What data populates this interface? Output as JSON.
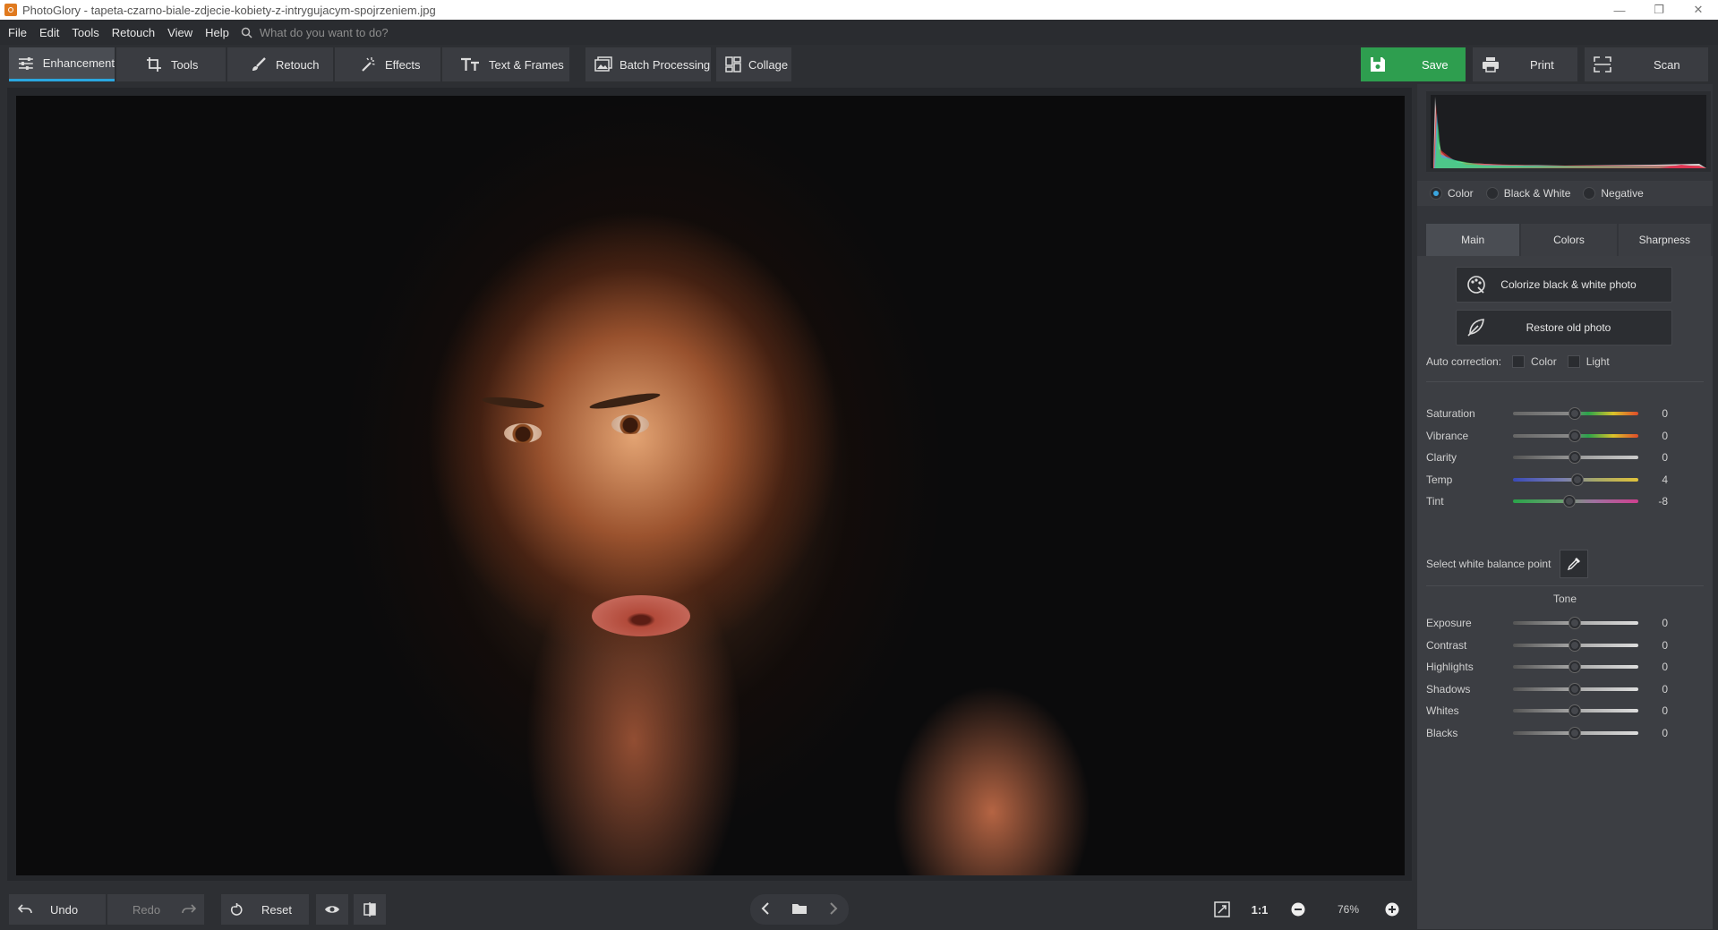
{
  "window": {
    "title": "PhotoGlory - tapeta-czarno-biale-zdjecie-kobiety-z-intrygujacym-spojrzeniem.jpg",
    "minimize": "—",
    "maximize": "❐",
    "close": "✕"
  },
  "menu": {
    "items": [
      "File",
      "Edit",
      "Tools",
      "Retouch",
      "View",
      "Help"
    ],
    "search_placeholder": "What do you want to do?"
  },
  "toolbar": {
    "tabs": [
      {
        "label": "Enhancement",
        "icon": "sliders-icon",
        "active": true
      },
      {
        "label": "Tools",
        "icon": "crop-icon"
      },
      {
        "label": "Retouch",
        "icon": "brush-icon"
      },
      {
        "label": "Effects",
        "icon": "magic-wand-icon"
      },
      {
        "label": "Text & Frames",
        "icon": "text-icon"
      }
    ],
    "batch_label": "Batch Processing",
    "collage_label": "Collage",
    "save_label": "Save",
    "print_label": "Print",
    "scan_label": "Scan",
    "save_color": "#2e9e4f",
    "accent_color": "#2aa7e0"
  },
  "panel": {
    "modes": [
      {
        "label": "Color",
        "selected": true
      },
      {
        "label": "Black & White",
        "selected": false
      },
      {
        "label": "Negative",
        "selected": false
      }
    ],
    "subtabs": [
      {
        "label": "Main",
        "active": true
      },
      {
        "label": "Colors",
        "active": false
      },
      {
        "label": "Sharpness",
        "active": false
      }
    ],
    "colorize_label": "Colorize black & white photo",
    "restore_label": "Restore old photo",
    "auto_correction": {
      "label": "Auto correction:",
      "color_label": "Color",
      "light_label": "Light",
      "color_checked": false,
      "light_checked": false
    },
    "color_sliders": [
      {
        "label": "Saturation",
        "value": "0",
        "position": 0.5
      },
      {
        "label": "Vibrance",
        "value": "0",
        "position": 0.5
      },
      {
        "label": "Clarity",
        "value": "0",
        "position": 0.5
      },
      {
        "label": "Temp",
        "value": "4",
        "position": 0.52
      },
      {
        "label": "Tint",
        "value": "-8",
        "position": 0.46
      }
    ],
    "white_balance_label": "Select white balance point",
    "tone_title": "Tone",
    "tone_sliders": [
      {
        "label": "Exposure",
        "value": "0",
        "position": 0.5
      },
      {
        "label": "Contrast",
        "value": "0",
        "position": 0.5
      },
      {
        "label": "Highlights",
        "value": "0",
        "position": 0.5
      },
      {
        "label": "Shadows",
        "value": "0",
        "position": 0.5
      },
      {
        "label": "Whites",
        "value": "0",
        "position": 0.5
      },
      {
        "label": "Blacks",
        "value": "0",
        "position": 0.5
      }
    ]
  },
  "bottom": {
    "undo_label": "Undo",
    "redo_label": "Redo",
    "reset_label": "Reset",
    "one_to_one": "1:1",
    "zoom": "76%"
  }
}
